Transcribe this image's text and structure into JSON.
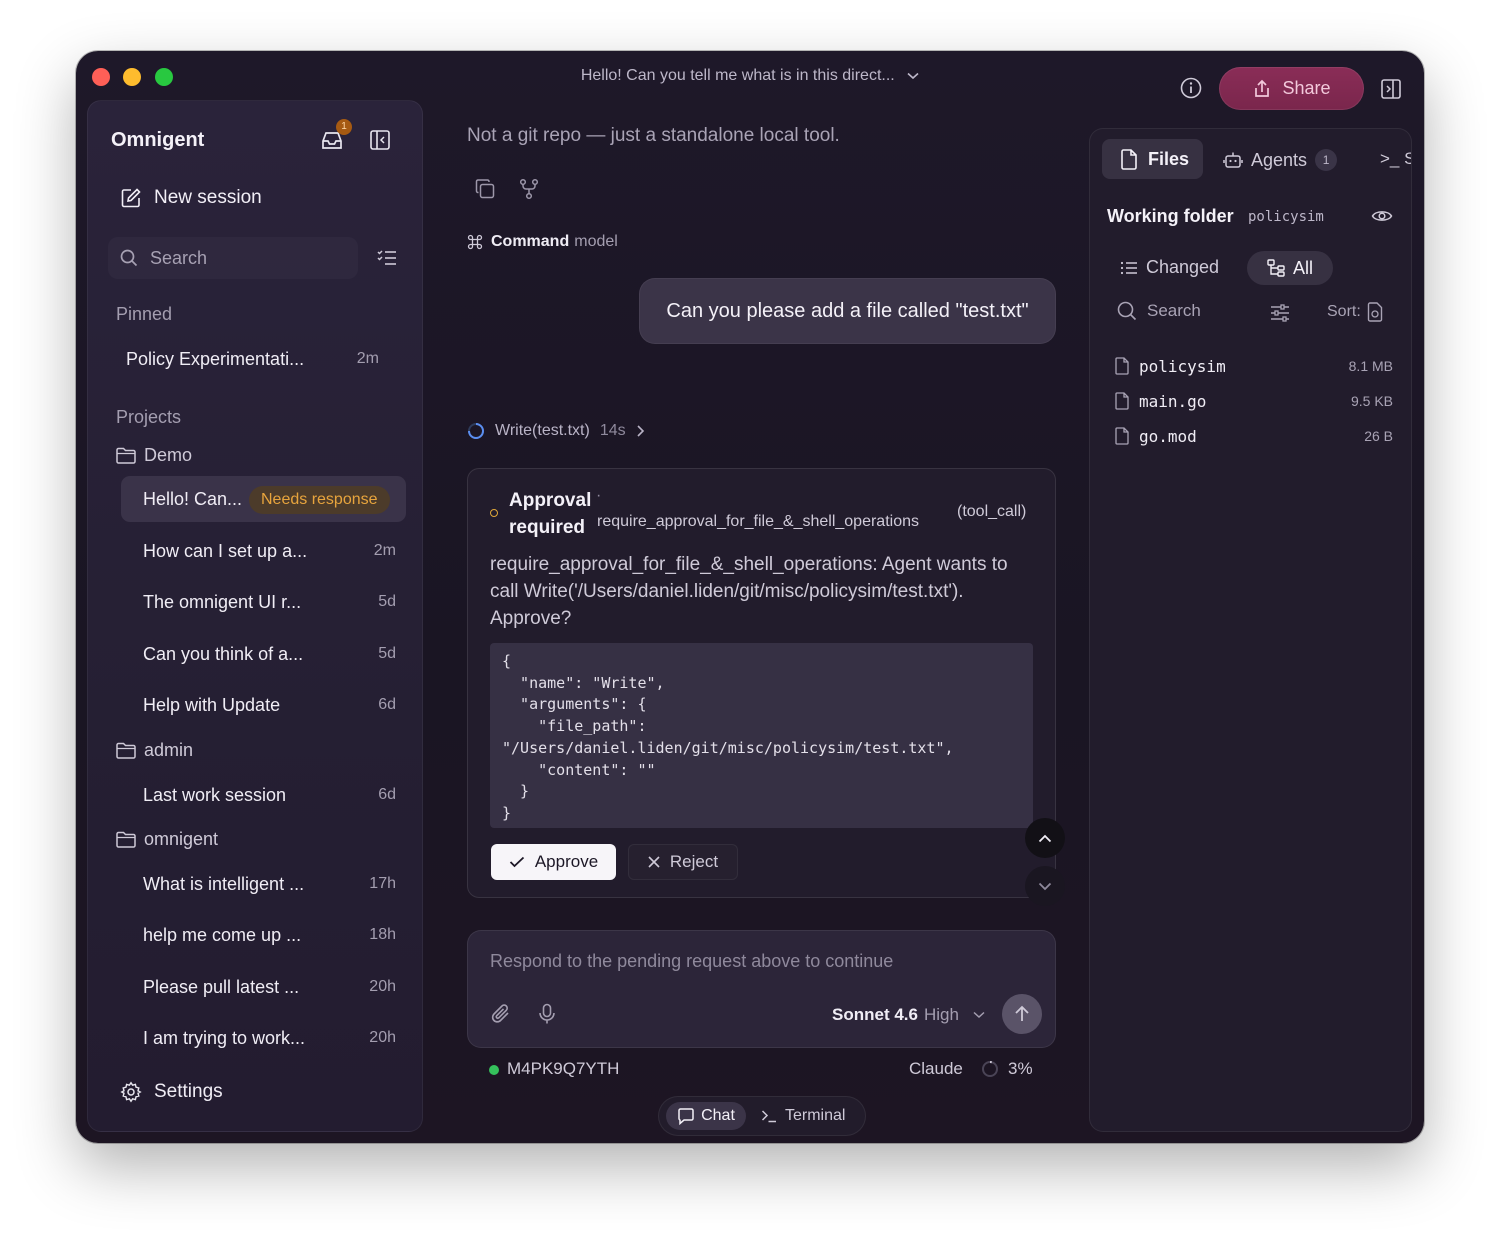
{
  "window": {
    "title": "Hello! Can you tell me what is in this direct...",
    "share_label": "Share"
  },
  "sidebar": {
    "brand": "Omnigent",
    "inbox_badge": "1",
    "new_session": "New session",
    "search_placeholder": "Search",
    "pinned_label": "Pinned",
    "pinned": [
      {
        "label": "Policy Experimentati...",
        "time": "2m"
      }
    ],
    "projects_label": "Projects",
    "projects": [
      {
        "name": "Demo",
        "items": [
          {
            "label": "Hello! Can...",
            "badge": "Needs response",
            "active": true
          },
          {
            "label": "How can I set up a...",
            "time": "2m"
          },
          {
            "label": "The omnigent UI r...",
            "time": "5d"
          },
          {
            "label": "Can you think of a...",
            "time": "5d"
          },
          {
            "label": "Help with Update",
            "time": "6d"
          }
        ]
      },
      {
        "name": "admin",
        "items": [
          {
            "label": "Last work session",
            "time": "6d"
          }
        ]
      },
      {
        "name": "omnigent",
        "items": [
          {
            "label": "What is intelligent ...",
            "time": "17h"
          },
          {
            "label": "help me come up ...",
            "time": "18h"
          },
          {
            "label": "Please pull latest ...",
            "time": "20h"
          },
          {
            "label": "I am trying to work...",
            "time": "20h"
          }
        ]
      }
    ],
    "settings": "Settings"
  },
  "chat": {
    "assistant_text": "Not a git repo — just a standalone local tool.",
    "command_label": "Command",
    "command_suffix": "model",
    "user_message": "Can you please add a file called \"test.txt\"",
    "tool_call": {
      "name": "Write(test.txt)",
      "elapsed": "14s"
    },
    "approval": {
      "title": "Approval required",
      "separator": "·",
      "rule": "require_approval_for_file_&_shell_operations",
      "type": "(tool_call)",
      "description": "require_approval_for_file_&_shell_operations: Agent wants to call Write('/Users/daniel.liden/git/misc/policysim/test.txt'). Approve?",
      "code": "{\n  \"name\": \"Write\",\n  \"arguments\": {\n    \"file_path\":\n\"/Users/daniel.liden/git/misc/policysim/test.txt\",\n    \"content\": \"\"\n  }\n}",
      "approve_label": "Approve",
      "reject_label": "Reject"
    },
    "composer": {
      "placeholder": "Respond to the pending request above to continue",
      "model": "Sonnet 4.6",
      "effort": "High"
    },
    "status": {
      "session_id": "M4PK9Q7YTH",
      "provider": "Claude",
      "context_pct": "3%",
      "context_fraction": 0.03,
      "online_color": "#35c15c"
    },
    "modes": {
      "chat": "Chat",
      "terminal": "Terminal",
      "active": "chat"
    }
  },
  "right_panel": {
    "tabs": {
      "files": "Files",
      "agents": "Agents",
      "agents_count": "1",
      "terminal_glyph": ">_ S"
    },
    "working_folder_label": "Working folder",
    "working_folder_name": "policysim",
    "filter": {
      "changed": "Changed",
      "all": "All",
      "active": "all"
    },
    "search_placeholder": "Search",
    "sort_label": "Sort:",
    "files": [
      {
        "name": "policysim",
        "size": "8.1 MB"
      },
      {
        "name": "main.go",
        "size": "9.5 KB"
      },
      {
        "name": "go.mod",
        "size": "26 B"
      }
    ]
  },
  "colors": {
    "accent_share": "#8a2d57",
    "needs_response": "#e7a43d",
    "close": "#fe5f57",
    "minimize": "#febc2e",
    "zoom": "#28c840"
  }
}
